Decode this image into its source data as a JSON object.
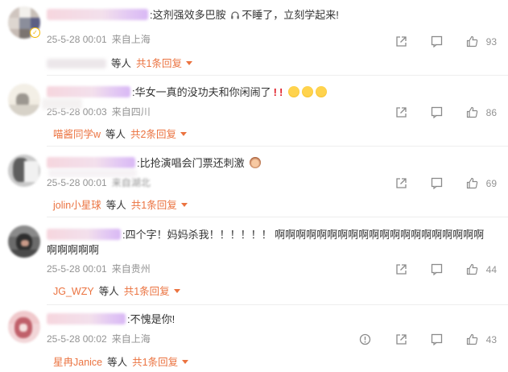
{
  "comments": [
    {
      "text": ":这剂强效多巴胺",
      "text2": "不睡了，立刻学起来!",
      "date": "25-5-28 00:01",
      "location": "来自上海",
      "replies_user": "",
      "replies_mid": "等人",
      "replies_link": "共1条回复",
      "likes": "93",
      "verified": "✓"
    },
    {
      "text": ":华女一真的没功夫和你闲闹了",
      "date": "25-5-28 00:03",
      "location": "来自四川",
      "replies_user": "喵酱同学w",
      "replies_mid": "等人",
      "replies_link": "共2条回复",
      "likes": "86"
    },
    {
      "text": ":比抢演唱会门票还刺激",
      "date": "25-5-28 00:01",
      "location": "来自湖北",
      "replies_user": "jolin小星球",
      "replies_mid": "等人",
      "replies_link": "共1条回复",
      "likes": "69"
    },
    {
      "text": ":四个字！妈妈杀我！！！！！！",
      "text_strong": "啊啊啊啊啊啊啊啊啊啊啊啊啊啊啊啊啊啊啊啊",
      "text_strong2": "啊啊啊啊啊",
      "date": "25-5-28 00:01",
      "location": "来自贵州",
      "replies_user": "JG_WZY",
      "replies_mid": "等人",
      "replies_link": "共1条回复",
      "likes": "44"
    },
    {
      "text": ":不愧是你!",
      "date": "25-5-28 00:02",
      "location": "来自上海",
      "replies_user": "星冉Janice",
      "replies_mid": "等人",
      "replies_link": "共1条回复",
      "likes": "43"
    }
  ],
  "icons": {
    "share": "share-icon",
    "comment": "comment-icon",
    "like": "thumbs-up-icon",
    "report": "report-icon",
    "headphones": "headphones-icon",
    "cry_emoji": "crying-face-emoji",
    "monkey_emoji": "see-no-evil-monkey-emoji"
  },
  "colors": {
    "accent": "#eb7340",
    "meta": "#939393",
    "red": "#e0202a"
  }
}
